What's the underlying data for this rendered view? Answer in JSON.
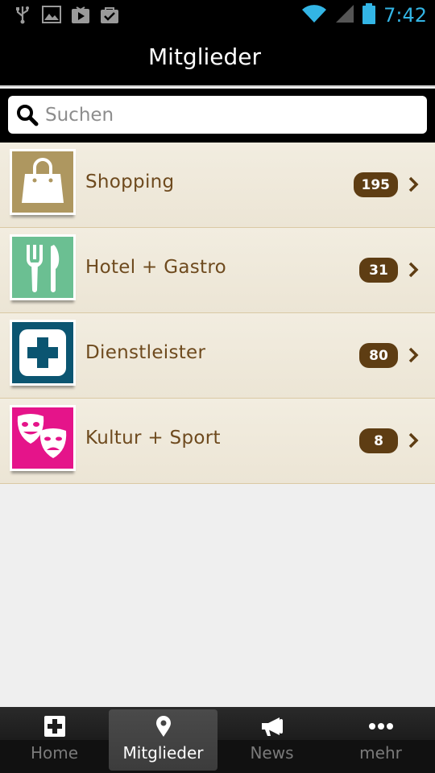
{
  "status_bar": {
    "time": "7:42",
    "left_icons": [
      "usb-icon",
      "image-icon",
      "play-store-icon",
      "bag-check-icon"
    ],
    "right_icons": [
      "wifi-icon",
      "signal-icon",
      "battery-icon"
    ],
    "time_color": "#33b5e5"
  },
  "header": {
    "title": "Mitglieder"
  },
  "search": {
    "placeholder": "Suchen",
    "value": ""
  },
  "categories": [
    {
      "label": "Shopping",
      "count": "195",
      "icon": "shopping-bag-icon",
      "color": "#ae9760"
    },
    {
      "label": "Hotel + Gastro",
      "count": "31",
      "icon": "fork-knife-icon",
      "color": "#6bbf92"
    },
    {
      "label": "Dienstleister",
      "count": "80",
      "icon": "plus-cross-icon",
      "color": "#0b5571"
    },
    {
      "label": "Kultur + Sport",
      "count": "8",
      "icon": "theater-masks-icon",
      "color": "#e5148a"
    }
  ],
  "tabs": [
    {
      "label": "Home",
      "icon": "home-plus-icon",
      "active": false
    },
    {
      "label": "Mitglieder",
      "icon": "map-pin-icon",
      "active": true
    },
    {
      "label": "News",
      "icon": "megaphone-icon",
      "active": false
    },
    {
      "label": "mehr",
      "icon": "more-dots-icon",
      "active": false
    }
  ],
  "colors": {
    "label_brown": "#6e4a1e",
    "badge_bg": "#5e3d13",
    "row_bg": "#f0eadd"
  }
}
